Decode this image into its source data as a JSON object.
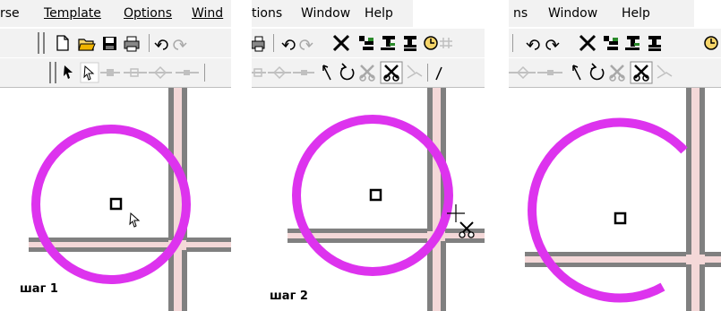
{
  "panel1": {
    "menu": {
      "m1": "rse",
      "m2": "Template",
      "m3": "Options",
      "m4": "Wind"
    },
    "step_label": "шаг 1"
  },
  "panel2": {
    "menu": {
      "m1": "tions",
      "m2": "Window",
      "m3": "Help"
    },
    "step_label": "шаг 2"
  },
  "panel3": {
    "menu": {
      "m1": "ns",
      "m2": "Window",
      "m3": "Help"
    }
  },
  "icons": {
    "toolbar1_p1": [
      "new-document-icon",
      "open-folder-icon",
      "save-icon",
      "print-icon",
      "undo-icon",
      "redo-icon"
    ],
    "toolbar2_p1": [
      "select-arrow-icon",
      "select-hollow-arrow-icon",
      "node-tool-icon",
      "node-add-icon",
      "node-diamond-icon",
      "node-delete-icon"
    ],
    "toolbar1_p2": [
      "print-icon",
      "undo-icon",
      "redo-icon",
      "delete-x-icon",
      "join-icon",
      "split-icon",
      "merge-icon",
      "clock-icon"
    ],
    "toolbar2_p2": [
      "node-tool-icon",
      "node-diamond-icon",
      "node-delete-icon",
      "arrow-tool-icon",
      "rotate-icon",
      "scissors-gray-icon",
      "scissors-active-icon",
      "cut-line-icon"
    ],
    "toolbar1_p3": [
      "undo-icon",
      "redo-icon",
      "delete-x-icon",
      "join-icon",
      "split-icon",
      "merge-icon",
      "clock-icon"
    ],
    "toolbar2_p3": [
      "node-diamond-icon",
      "node-delete-icon",
      "arrow-tool-icon",
      "rotate-icon",
      "scissors-gray-icon",
      "scissors-active-icon",
      "cut-line-icon"
    ]
  },
  "colors": {
    "circle": "#dd33ee",
    "road_edge": "#808080",
    "road_fill": "#f4d8d8",
    "toolbar_bg": "#f2f2f2"
  }
}
